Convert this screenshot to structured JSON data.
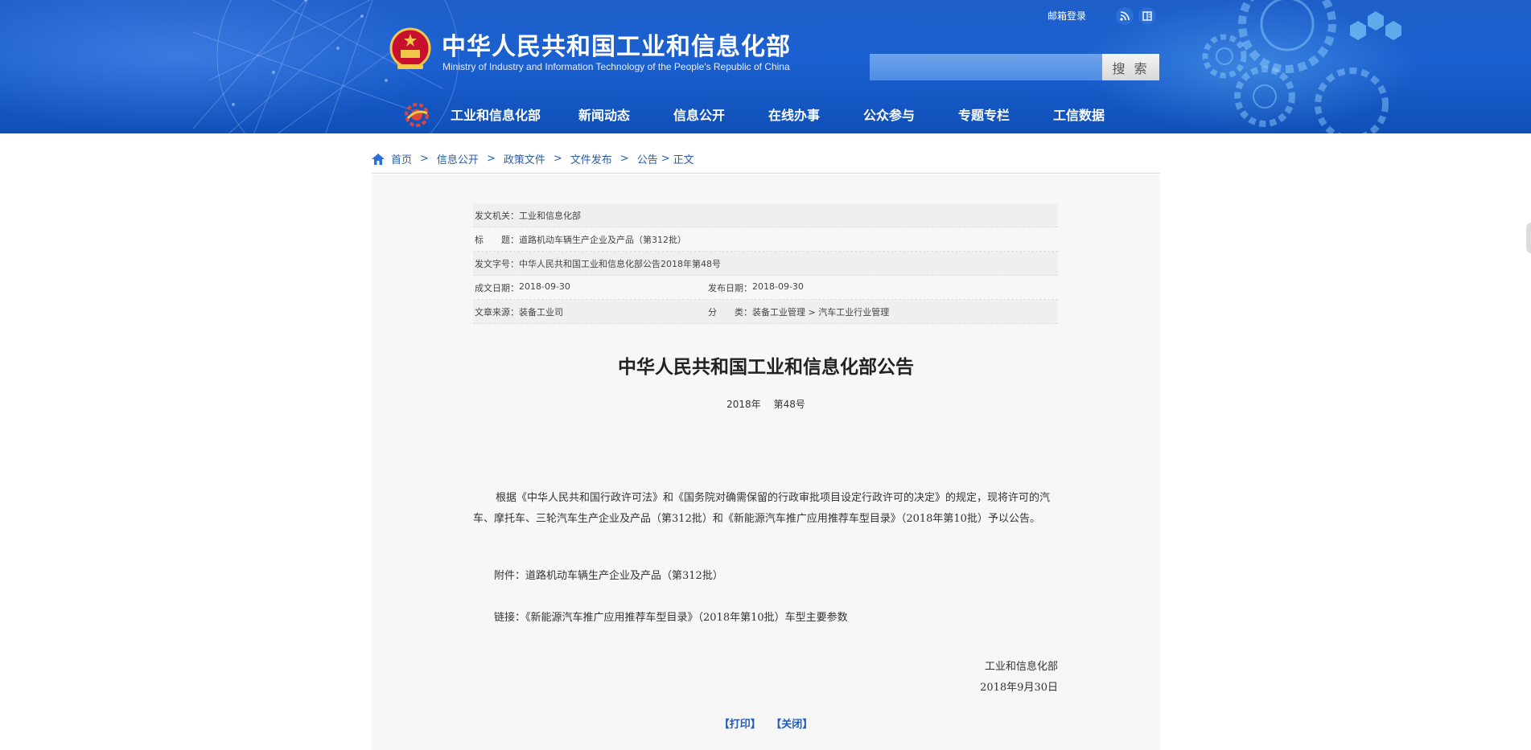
{
  "header": {
    "title": "中华人民共和国工业和信息化部",
    "subtitle": "Ministry of Industry and Information Technology of the People's Republic of China",
    "mail_login": "邮箱登录",
    "search_placeholder": "",
    "search_button": "搜 索",
    "icons": [
      "rss-icon",
      "book-icon"
    ]
  },
  "nav": {
    "items": [
      "工业和信息化部",
      "新闻动态",
      "信息公开",
      "在线办事",
      "公众参与",
      "专题专栏",
      "工信数据"
    ]
  },
  "breadcrumb": {
    "items": [
      "首页",
      "信息公开",
      "政策文件",
      "文件发布",
      "公告",
      "正文"
    ],
    "separator": ">"
  },
  "meta": {
    "issuer_label": "发文机关：",
    "issuer": "工业和信息化部",
    "title_label": "标　　题：",
    "title": "道路机动车辆生产企业及产品（第312批）",
    "doc_no_label": "发文字号：",
    "doc_no": "中华人民共和国工业和信息化部公告2018年第48号",
    "created_label": "成文日期：",
    "created": "2018-09-30",
    "published_label": "发布日期：",
    "published": "2018-09-30",
    "source_label": "文章来源：",
    "source": "装备工业司",
    "category_label": "分　　类：",
    "category": "装备工业管理 > 汽车工业行业管理"
  },
  "document": {
    "title": "中华人民共和国工业和信息化部公告",
    "year": "2018年",
    "number": "第48号",
    "body": "根据《中华人民共和国行政许可法》和《国务院对确需保留的行政审批项目设定行政许可的决定》的规定，现将许可的汽车、摩托车、三轮汽车生产企业及产品（第312批）和《新能源汽车推广应用推荐车型目录》（2018年第10批）予以公告。",
    "attachment_label": "附件：",
    "attachment": "道路机动车辆生产企业及产品（第312批）",
    "link_label": "链接：",
    "link": "《新能源汽车推广应用推荐车型目录》（2018年第10批）车型主要参数",
    "signature_org": "工业和信息化部",
    "signature_date": "2018年9月30日"
  },
  "actions": {
    "print": "【打印】",
    "close": "【关闭】"
  },
  "colors": {
    "header_blue": "#1b60d0",
    "link_blue": "#2a5ea8",
    "action_blue": "#1f5cbf"
  }
}
